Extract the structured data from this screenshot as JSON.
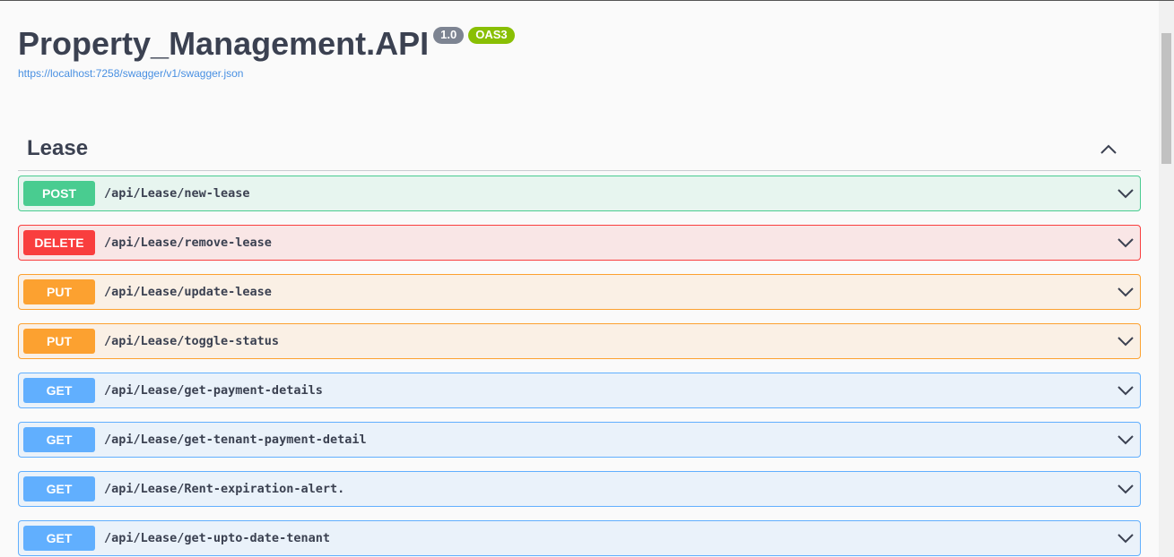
{
  "info": {
    "title": "Property_Management.API",
    "version_badge": "1.0",
    "oas_badge": "OAS3",
    "spec_url": "https://localhost:7258/swagger/v1/swagger.json"
  },
  "tag": {
    "name": "Lease"
  },
  "colors": {
    "post": "#49cc90",
    "delete": "#f93e3e",
    "put": "#fca130",
    "get": "#61affe"
  },
  "operations": [
    {
      "method": "POST",
      "path": "/api/Lease/new-lease"
    },
    {
      "method": "DELETE",
      "path": "/api/Lease/remove-lease"
    },
    {
      "method": "PUT",
      "path": "/api/Lease/update-lease"
    },
    {
      "method": "PUT",
      "path": "/api/Lease/toggle-status"
    },
    {
      "method": "GET",
      "path": "/api/Lease/get-payment-details"
    },
    {
      "method": "GET",
      "path": "/api/Lease/get-tenant-payment-detail"
    },
    {
      "method": "GET",
      "path": "/api/Lease/Rent-expiration-alert."
    },
    {
      "method": "GET",
      "path": "/api/Lease/get-upto-date-tenant"
    }
  ]
}
